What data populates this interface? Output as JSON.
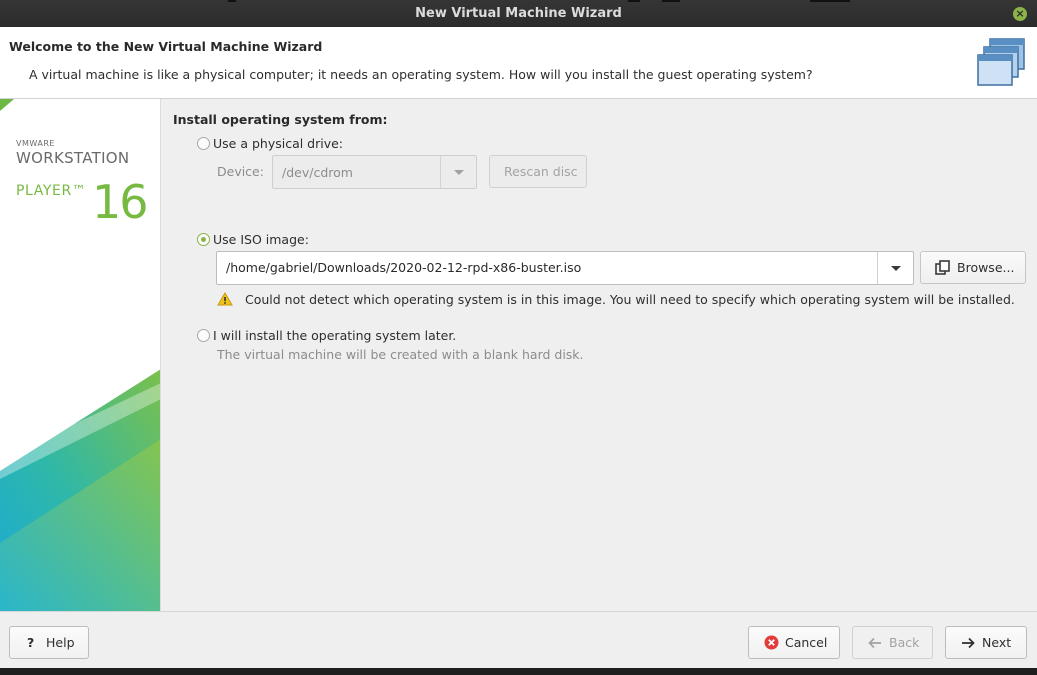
{
  "window": {
    "title": "New Virtual Machine Wizard"
  },
  "header": {
    "title": "Welcome to the New Virtual Machine Wizard",
    "subtitle": "A virtual machine is like a physical computer; it needs an operating system. How will you install the guest operating system?"
  },
  "brand": {
    "vendor": "VMWARE",
    "product": "WORKSTATION",
    "edition": "PLAYER™",
    "version": "16"
  },
  "install": {
    "section_title": "Install operating system from:",
    "physical": {
      "label": "Use a physical drive:",
      "selected": false,
      "device_label": "Device:",
      "device_value": "/dev/cdrom",
      "rescan_label": "Rescan disc"
    },
    "iso": {
      "label": "Use ISO image:",
      "selected": true,
      "path": "/home/gabriel/Downloads/2020-02-12-rpd-x86-buster.iso",
      "browse_label": "Browse...",
      "warning": "Could not detect which operating system is in this image. You will need to specify which operating system will be installed."
    },
    "later": {
      "label": "I will install the operating system later.",
      "selected": false,
      "note": "The virtual machine will be created with a blank hard disk."
    }
  },
  "footer": {
    "help_label": "Help",
    "cancel_label": "Cancel",
    "back_label": "Back",
    "next_label": "Next"
  },
  "colors": {
    "accent": "#8ab34a",
    "brand_green": "#78b942",
    "error_red": "#e23b3b"
  }
}
